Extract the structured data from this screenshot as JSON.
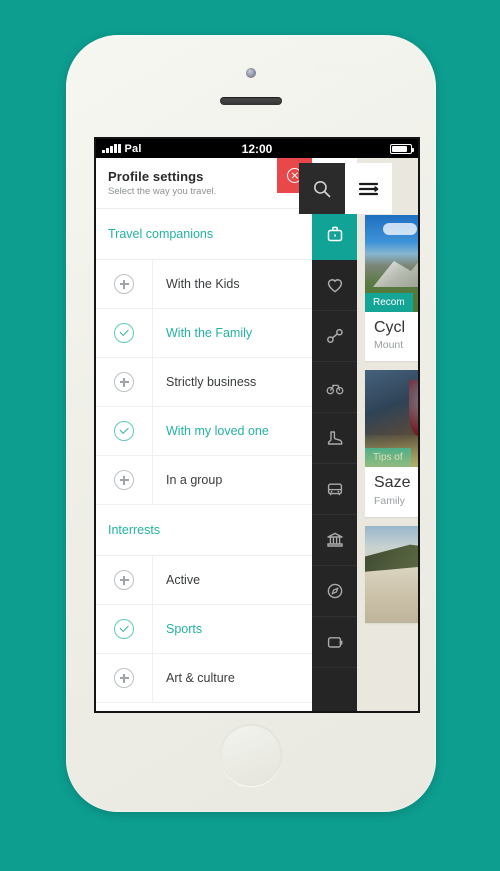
{
  "theme": {
    "page_background": "#0d9e90",
    "accent_teal": "#24b2a2",
    "rail_dark": "#252525",
    "close_red": "#e8484a",
    "card_background": "#eae7de"
  },
  "status_bar": {
    "carrier": "Pal",
    "signal_icon": "signal-bars-icon",
    "time": "12:00",
    "battery_icon": "battery-icon"
  },
  "header": {
    "title": "Profile settings",
    "subtitle": "Select the way you travel.",
    "close_label": "close-icon",
    "search_label": "search-icon",
    "menu_label": "menu-icon"
  },
  "sections": [
    {
      "id": "travel-companions",
      "title": "Travel companions",
      "options": [
        {
          "label": "With the Kids",
          "selected": false,
          "mark": "plus"
        },
        {
          "label": "With the Family",
          "selected": true,
          "mark": "check"
        },
        {
          "label": "Strictly business",
          "selected": false,
          "mark": "plus"
        },
        {
          "label": "With my loved one",
          "selected": true,
          "mark": "check"
        },
        {
          "label": "In a group",
          "selected": false,
          "mark": "plus"
        }
      ]
    },
    {
      "id": "interrests",
      "title": "Interrests",
      "options": [
        {
          "label": "Active",
          "selected": false,
          "mark": "plus"
        },
        {
          "label": "Sports",
          "selected": true,
          "mark": "check"
        },
        {
          "label": "Art & culture",
          "selected": false,
          "mark": "plus"
        }
      ]
    }
  ],
  "icon_rail": [
    {
      "name": "person-icon",
      "state": "light"
    },
    {
      "name": "suitcase-icon",
      "state": "active"
    },
    {
      "name": "heart-icon",
      "state": "dark"
    },
    {
      "name": "network-icon",
      "state": "dark"
    },
    {
      "name": "bicycle-icon",
      "state": "dark"
    },
    {
      "name": "boot-icon",
      "state": "dark"
    },
    {
      "name": "bus-icon",
      "state": "dark"
    },
    {
      "name": "museum-icon",
      "state": "dark"
    },
    {
      "name": "compass-icon",
      "state": "dark"
    },
    {
      "name": "wallet-icon",
      "state": "dark"
    }
  ],
  "content_strip": {
    "weather_icon": "sun-cloud-icon",
    "cards": [
      {
        "badge": "Recom",
        "title": "Cycl",
        "subtitle": "Mount",
        "photo": "mountain"
      },
      {
        "badge": "Tips of",
        "title": "Saze",
        "subtitle": "Family",
        "photo": "wine"
      },
      {
        "badge": "",
        "title": "",
        "subtitle": "",
        "photo": "beach"
      }
    ]
  }
}
